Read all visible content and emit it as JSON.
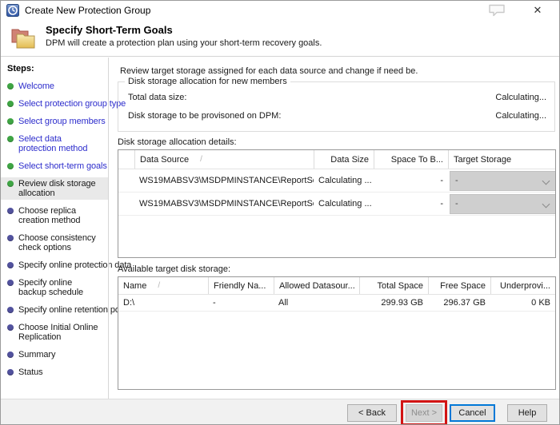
{
  "window": {
    "title": "Create New Protection Group",
    "close_glyph": "✕"
  },
  "header": {
    "title": "Specify Short-Term Goals",
    "subtitle": "DPM will create a protection plan using your short-term recovery goals."
  },
  "sidebar": {
    "heading": "Steps:",
    "items": [
      {
        "label": "Welcome",
        "state": "done"
      },
      {
        "label": "Select protection group type",
        "state": "done"
      },
      {
        "label": "Select group members",
        "state": "done"
      },
      {
        "label": "Select data protection method",
        "state": "done"
      },
      {
        "label": "Select short-term goals",
        "state": "done"
      },
      {
        "label": "Review disk storage allocation",
        "state": "current"
      },
      {
        "label": "Choose replica creation method",
        "state": "todo"
      },
      {
        "label": "Choose consistency check options",
        "state": "todo"
      },
      {
        "label": "Specify online protection data",
        "state": "todo"
      },
      {
        "label": "Specify online backup schedule",
        "state": "todo"
      },
      {
        "label": "Specify online retention policy",
        "state": "todo"
      },
      {
        "label": "Choose Initial Online Replication",
        "state": "todo"
      },
      {
        "label": "Summary",
        "state": "todo"
      },
      {
        "label": "Status",
        "state": "todo"
      }
    ]
  },
  "main": {
    "instruction": "Review target storage assigned for each data source and change if need be.",
    "allocation_box": {
      "legend": "Disk storage allocation for new members",
      "total_label": "Total data size:",
      "total_value": "Calculating...",
      "provisioned_label": "Disk storage to be provisoned on DPM:",
      "provisioned_value": "Calculating..."
    },
    "details_table": {
      "label": "Disk storage allocation details:",
      "sort_glyph": "/",
      "columns": {
        "data_source": "Data Source",
        "data_size": "Data Size",
        "space_to_b": "Space To B...",
        "target_storage": "Target Storage"
      },
      "rows": [
        {
          "data_source": "WS19MABSV3\\MSDPMINSTANCE\\ReportServe...",
          "data_size": "Calculating ...",
          "space_to_b": "-",
          "target_storage": "-"
        },
        {
          "data_source": "WS19MABSV3\\MSDPMINSTANCE\\ReportServe...",
          "data_size": "Calculating ...",
          "space_to_b": "-",
          "target_storage": "-"
        }
      ]
    },
    "storage_table": {
      "label": "Available target disk storage:",
      "sort_glyph": "/",
      "columns": {
        "name": "Name",
        "friendly_name": "Friendly Na...",
        "allowed": "Allowed Datasour...",
        "total_space": "Total Space",
        "free_space": "Free Space",
        "underprovisioned": "Underprovi..."
      },
      "rows": [
        {
          "name": "D:\\",
          "friendly_name": "-",
          "allowed": "All",
          "total_space": "299.93 GB",
          "free_space": "296.37 GB",
          "underprovisioned": "0 KB"
        }
      ]
    }
  },
  "footer": {
    "back": "< Back",
    "next": "Next >",
    "cancel": "Cancel",
    "help": "Help"
  },
  "colors": {
    "link": "#2d2dcc",
    "done-bullet": "#3fa544",
    "todo-bullet": "#52529e",
    "annotation": "#d21414",
    "focus": "#0078d7"
  }
}
